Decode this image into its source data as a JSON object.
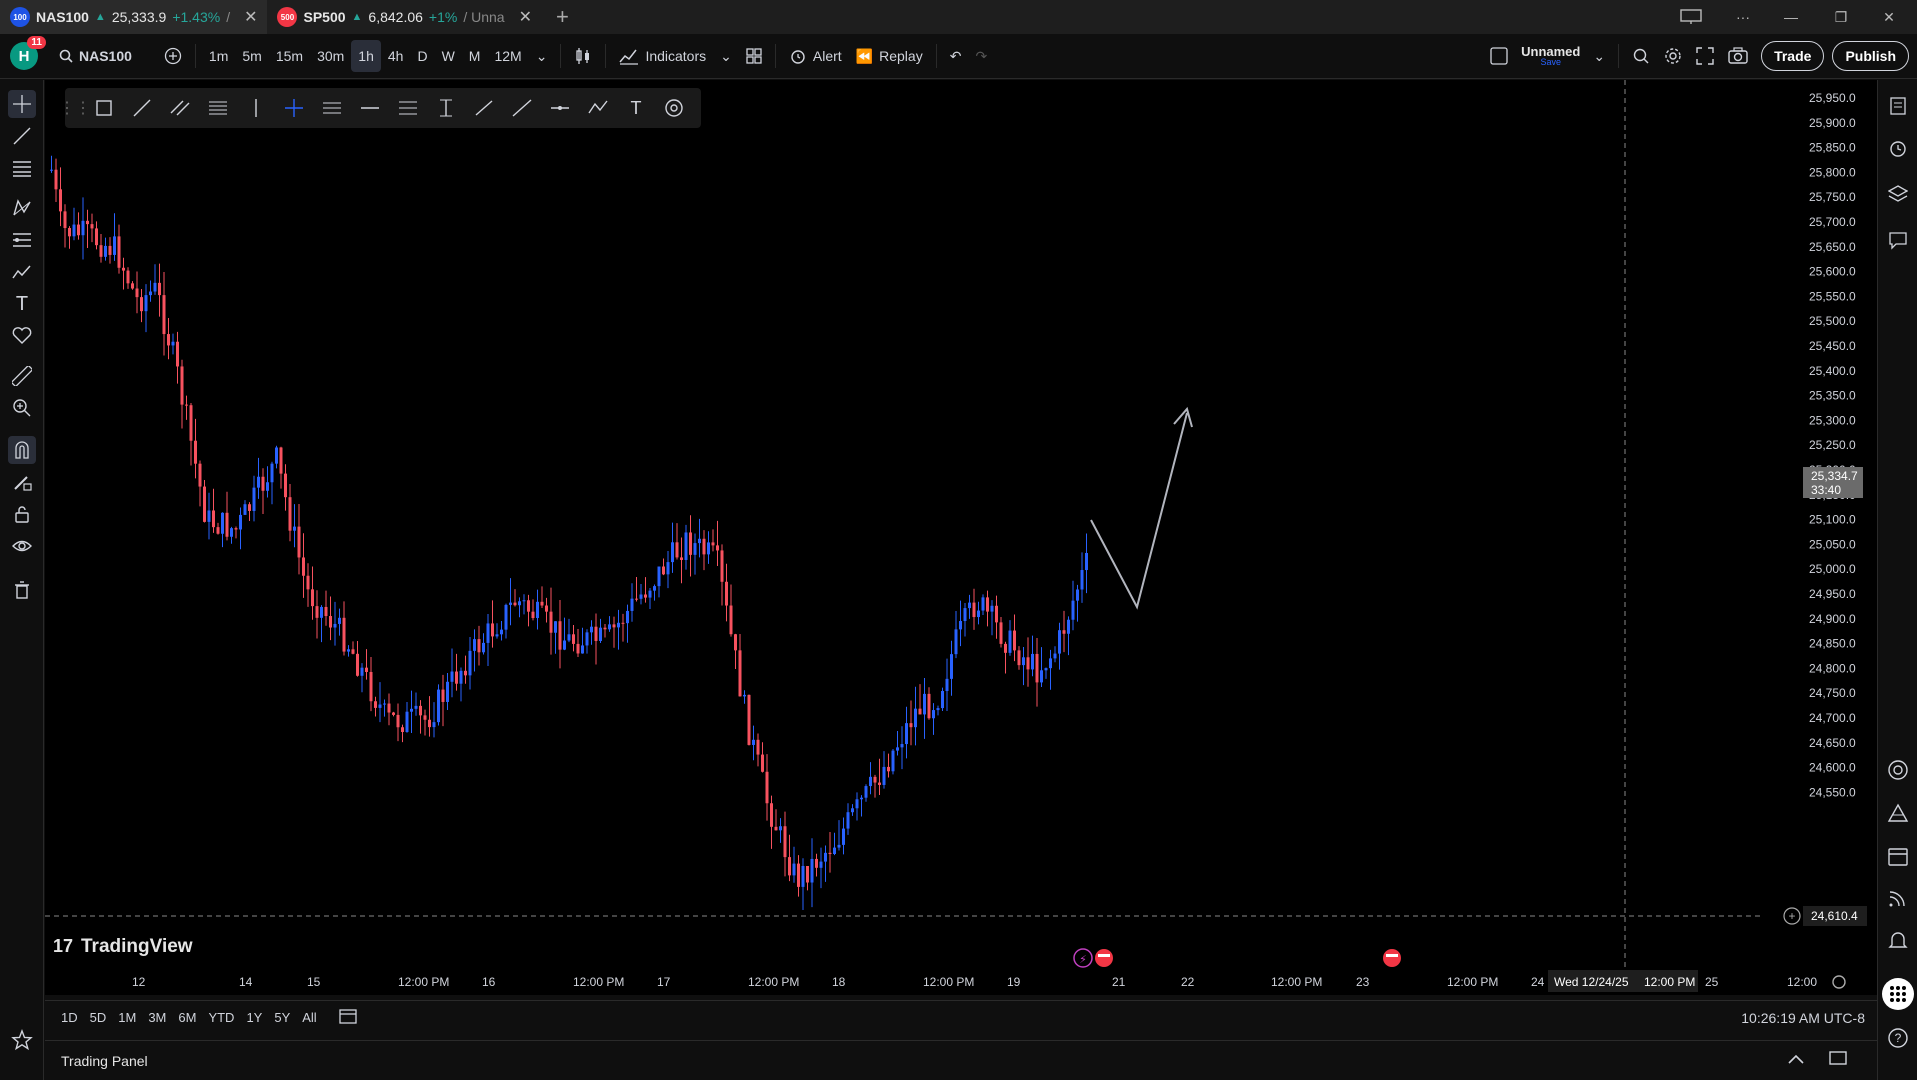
{
  "tabs": [
    {
      "badge": "100",
      "badge_color": "#1e53e5",
      "symbol": "NAS100",
      "price": "25,333.9",
      "change": "+1.43%",
      "rest": "/ ",
      "active": true
    },
    {
      "badge": "500",
      "badge_color": "#f23645",
      "symbol": "SP500",
      "price": "6,842.06",
      "change": "+1%",
      "rest": "/ Unna",
      "active": false
    }
  ],
  "toolbar": {
    "avatar_letter": "H",
    "avatar_notifications": "11",
    "symbol": "NAS100",
    "intervals": [
      "1m",
      "5m",
      "15m",
      "30m",
      "1h",
      "4h",
      "D",
      "W",
      "M",
      "12M"
    ],
    "active_interval": "1h",
    "indicators_label": "Indicators",
    "alert_label": "Alert",
    "replay_label": "Replay",
    "layout_name": "Unnamed",
    "layout_save": "Save",
    "trade_label": "Trade",
    "publish_label": "Publish"
  },
  "chart": {
    "branding": "TradingView",
    "current_price": "25,334.7",
    "countdown": "33:40",
    "crosshair_price": "24,610.4",
    "crosshair_date": "Wed 12/24/25",
    "crosshair_time": "12:00 PM",
    "price_ticks": [
      "25,950.0",
      "25,900.0",
      "25,850.0",
      "25,800.0",
      "25,750.0",
      "25,700.0",
      "25,650.0",
      "25,600.0",
      "25,550.0",
      "25,500.0",
      "25,450.0",
      "25,400.0",
      "25,350.0",
      "25,300.0",
      "25,250.0",
      "25,200.0",
      "25,150.0",
      "25,100.0",
      "25,050.0",
      "25,000.0",
      "24,950.0",
      "24,900.0",
      "24,850.0",
      "24,800.0",
      "24,750.0",
      "24,700.0",
      "24,650.0",
      "24,600.0",
      "24,550.0"
    ],
    "time_ticks": [
      "12",
      "14",
      "15",
      "12:00 PM",
      "16",
      "12:00 PM",
      "17",
      "12:00 PM",
      "18",
      "12:00 PM",
      "19",
      "21",
      "22",
      "12:00 PM",
      "23",
      "12:00 PM",
      "24",
      "25",
      "12:00"
    ],
    "colors": {
      "up": "#2962ff",
      "down": "#f7525f",
      "background": "#000000",
      "projection": "#b2b5be"
    }
  },
  "range": {
    "buttons": [
      "1D",
      "5D",
      "1M",
      "3M",
      "6M",
      "YTD",
      "1Y",
      "5Y",
      "All"
    ],
    "clock": "10:26:19 AM UTC-8"
  },
  "panel": {
    "trading_panel_label": "Trading Panel"
  }
}
